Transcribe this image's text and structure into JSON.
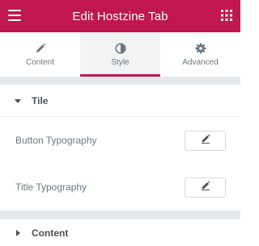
{
  "header": {
    "title": "Edit Hostzine Tab",
    "background": "#c1174f",
    "left_icon": "hamburger-menu-icon",
    "right_icon": "apps-grid-icon"
  },
  "tabs": [
    {
      "label": "Content",
      "icon": "pencil-icon",
      "active": false
    },
    {
      "label": "Style",
      "icon": "half-circle-contrast-icon",
      "active": true
    },
    {
      "label": "Advanced",
      "icon": "gear-icon",
      "active": false
    }
  ],
  "sections": {
    "tile": {
      "title": "Tile",
      "expanded": true,
      "controls": [
        {
          "label": "Button Typography",
          "action_icon": "pencil-icon"
        },
        {
          "label": "Title Typography",
          "action_icon": "pencil-icon"
        }
      ]
    },
    "content": {
      "title": "Content",
      "expanded": false
    }
  },
  "colors": {
    "accent": "#c1174f",
    "text_muted": "#6d7882",
    "text_dark": "#495157",
    "panel_gap": "#e6e9ec"
  }
}
